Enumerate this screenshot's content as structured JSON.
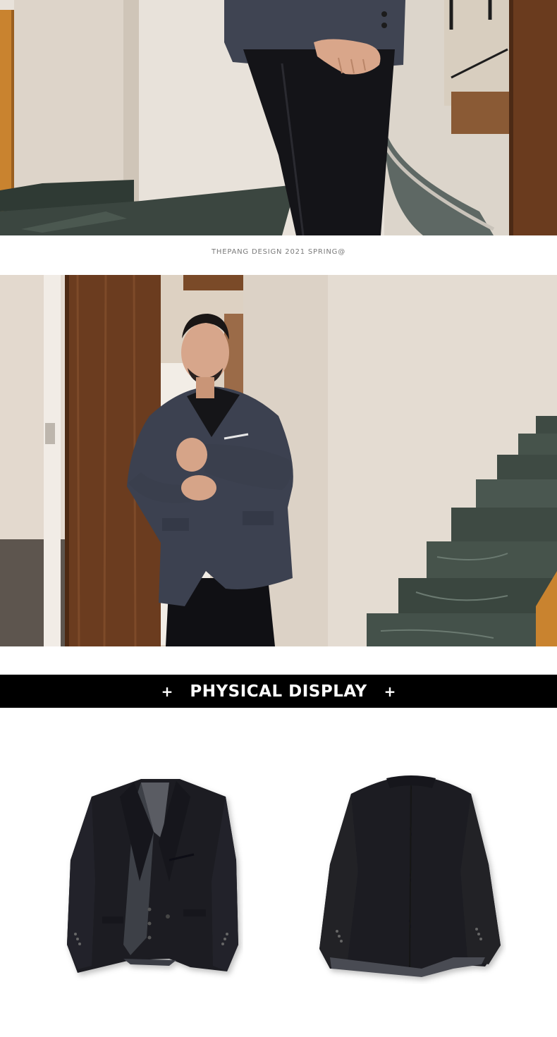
{
  "caption": "THEPANG DESIGN 2021 SPRING@",
  "section": {
    "left_mark": "+",
    "title": "PHYSICAL DISPLAY",
    "right_mark": "+"
  },
  "colors": {
    "wall": "#e9e1d8",
    "wood": "#6b3c1f",
    "suit": "#3f4452",
    "marble": "#3e4a43",
    "bar": "#000000",
    "caption": "#7a7a7a"
  }
}
